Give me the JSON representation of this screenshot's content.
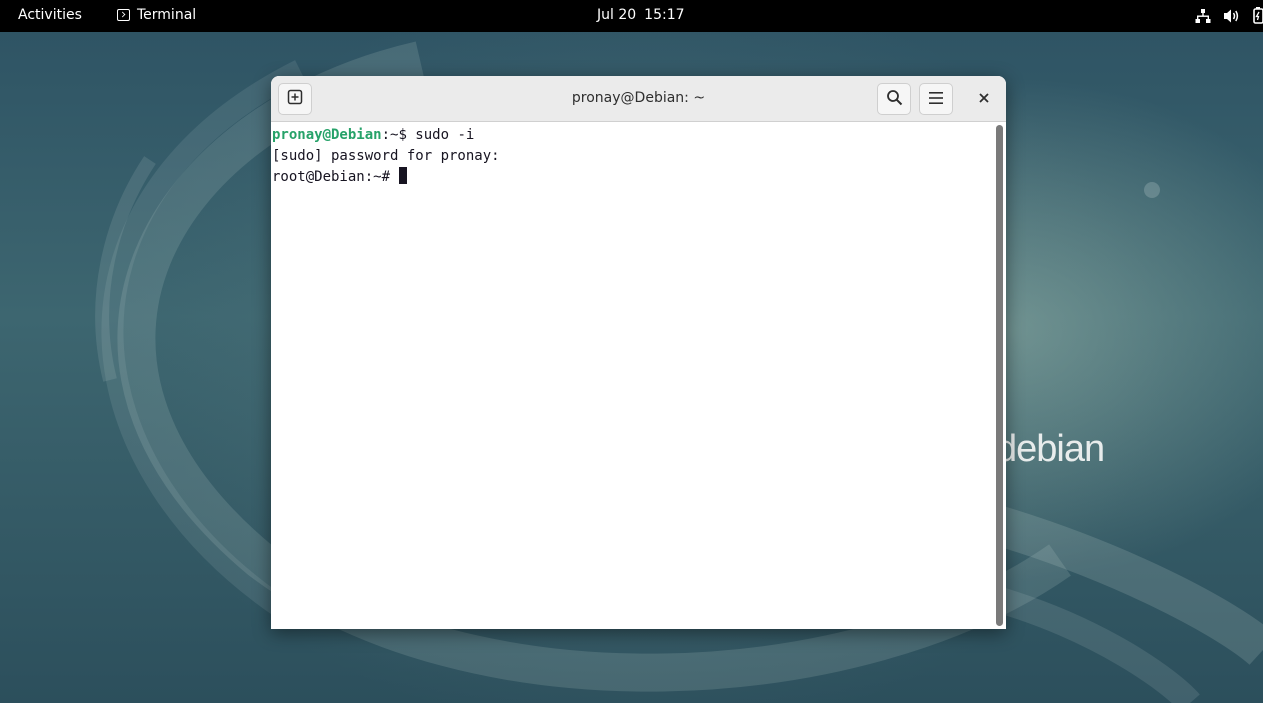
{
  "topbar": {
    "activities_label": "Activities",
    "app_name": "Terminal",
    "date": "Jul 20",
    "time": "15:17",
    "tray_icons": [
      "network-icon",
      "volume-icon",
      "battery-icon"
    ]
  },
  "desktop": {
    "wordmark": "debian"
  },
  "window": {
    "title": "pronay@Debian: ~",
    "buttons": {
      "new_tab": "new-tab-icon",
      "search": "search-icon",
      "menu": "hamburger-menu-icon",
      "close": "close-icon"
    }
  },
  "terminal": {
    "lines": [
      {
        "user": "pronay@Debian",
        "path": ":~",
        "sym": "$ ",
        "text": "sudo -i"
      },
      {
        "text": "[sudo] password for pronay:"
      },
      {
        "text": "root@Debian:~# "
      }
    ]
  },
  "colors": {
    "topbar_bg": "#000000",
    "headerbar_bg": "#ebebeb",
    "prompt_user": "#26a269",
    "terminal_fg": "#171421",
    "terminal_bg": "#ffffff"
  }
}
